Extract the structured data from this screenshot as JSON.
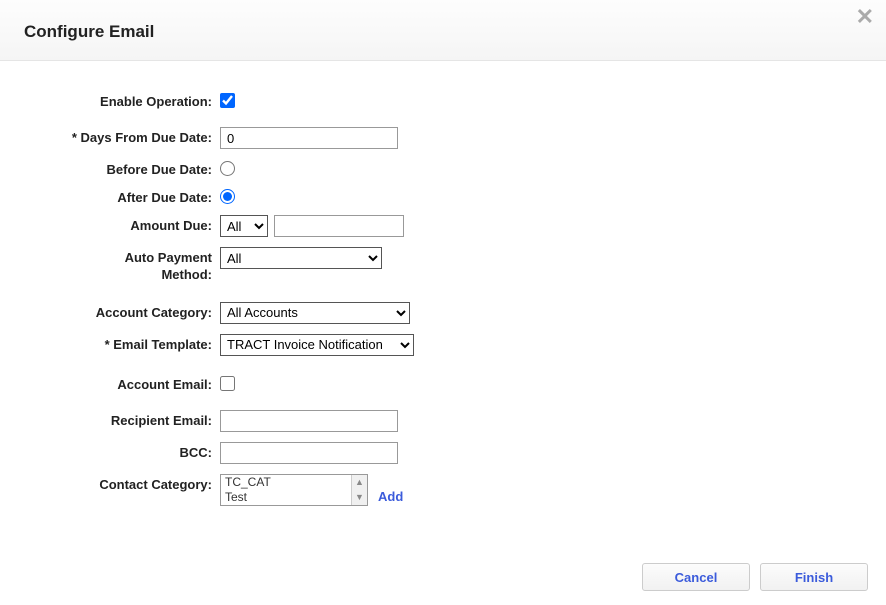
{
  "header": {
    "title": "Configure Email"
  },
  "form": {
    "enable_operation": {
      "label": "Enable Operation:",
      "checked": true
    },
    "days_from_due_date": {
      "label": "* Days From Due Date:",
      "value": "0"
    },
    "before_due_date": {
      "label": "Before Due Date:",
      "selected": false
    },
    "after_due_date": {
      "label": "After Due Date:",
      "selected": true
    },
    "amount_due": {
      "label": "Amount Due:",
      "select_value": "All",
      "input_value": ""
    },
    "auto_payment_method": {
      "label": "Auto Payment Method:",
      "value": "All"
    },
    "account_category": {
      "label": "Account Category:",
      "value": "All Accounts"
    },
    "email_template": {
      "label": "* Email Template:",
      "value": "TRACT Invoice Notification"
    },
    "account_email": {
      "label": "Account Email:",
      "checked": false
    },
    "recipient_email": {
      "label": "Recipient Email:",
      "value": ""
    },
    "bcc": {
      "label": "BCC:",
      "value": ""
    },
    "contact_category": {
      "label": "Contact Category:",
      "options": [
        "TC_CAT",
        "Test"
      ],
      "add_label": "Add"
    }
  },
  "footer": {
    "cancel": "Cancel",
    "finish": "Finish"
  }
}
